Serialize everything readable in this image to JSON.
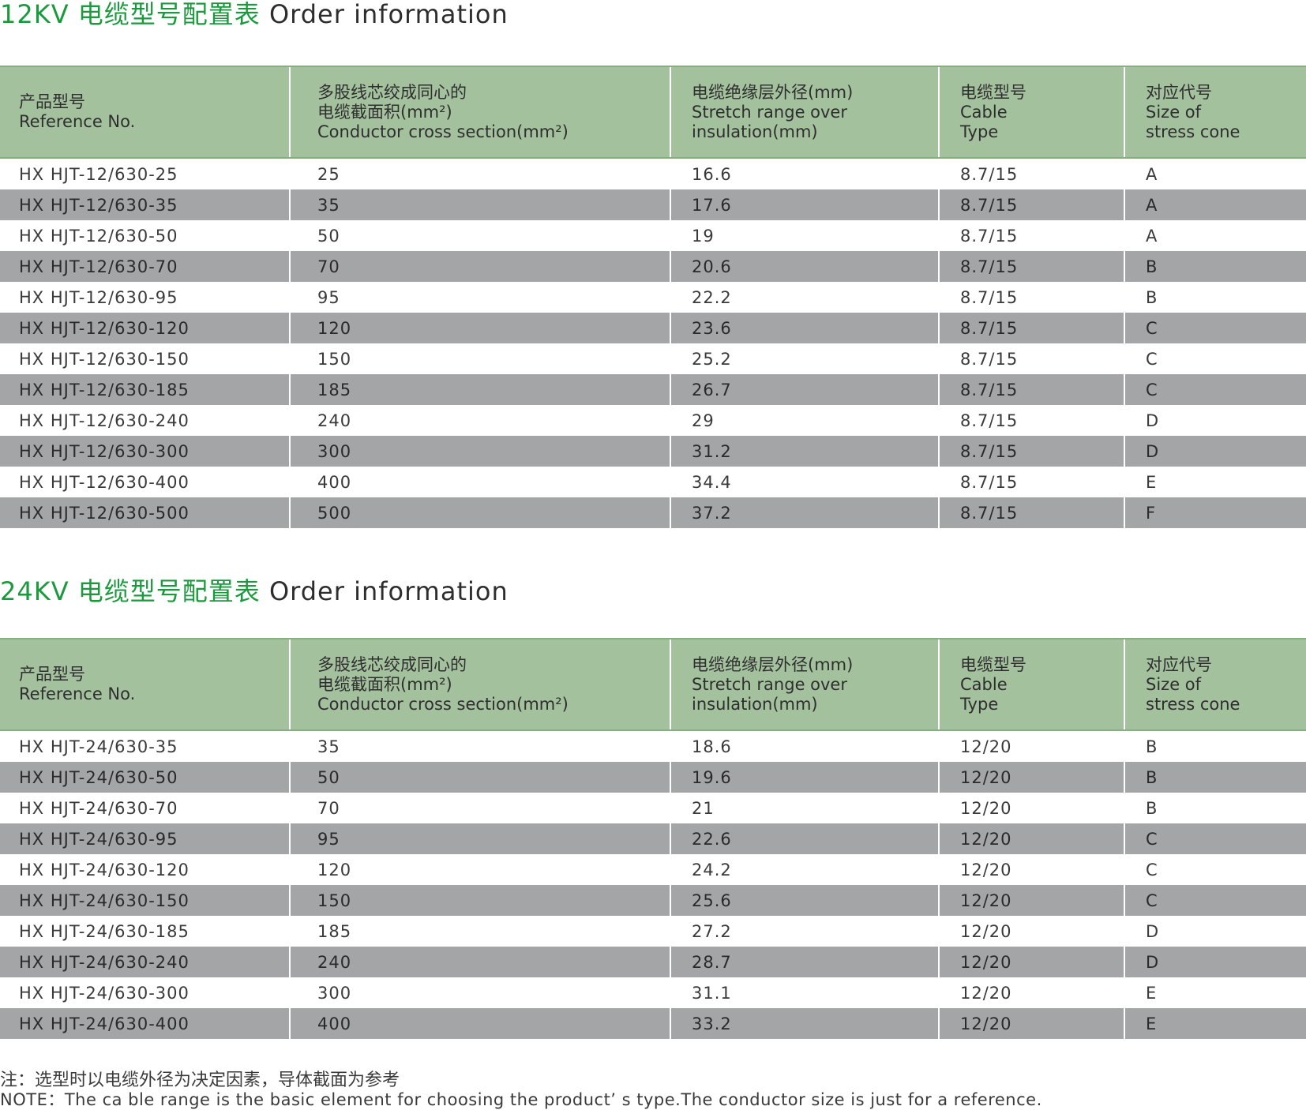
{
  "tables": [
    {
      "title_cn": "12KV 电缆型号配置表",
      "title_en": "Order information",
      "headers": {
        "c1": [
          "产品型号",
          "Reference No."
        ],
        "c2": [
          "多股线芯绞成同心的",
          "电缆截面积(mm²)",
          "Conductor cross section(mm²)"
        ],
        "c3": [
          "电缆绝缘层外径(mm)",
          "Stretch range over",
          "insulation(mm)"
        ],
        "c4": [
          "电缆型号",
          "Cable",
          "Type"
        ],
        "c5": [
          "对应代号",
          "Size of",
          "stress cone"
        ]
      },
      "rows": [
        [
          "HX HJT-12/630-25",
          "25",
          "16.6",
          "8.7/15",
          "A"
        ],
        [
          "HX HJT-12/630-35",
          "35",
          "17.6",
          "8.7/15",
          "A"
        ],
        [
          "HX HJT-12/630-50",
          "50",
          "19",
          "8.7/15",
          "A"
        ],
        [
          "HX HJT-12/630-70",
          "70",
          "20.6",
          "8.7/15",
          "B"
        ],
        [
          "HX HJT-12/630-95",
          "95",
          "22.2",
          "8.7/15",
          "B"
        ],
        [
          "HX HJT-12/630-120",
          "120",
          "23.6",
          "8.7/15",
          "C"
        ],
        [
          "HX HJT-12/630-150",
          "150",
          "25.2",
          "8.7/15",
          "C"
        ],
        [
          "HX HJT-12/630-185",
          "185",
          "26.7",
          "8.7/15",
          "C"
        ],
        [
          "HX HJT-12/630-240",
          "240",
          "29",
          "8.7/15",
          "D"
        ],
        [
          "HX HJT-12/630-300",
          "300",
          "31.2",
          "8.7/15",
          "D"
        ],
        [
          "HX HJT-12/630-400",
          "400",
          "34.4",
          "8.7/15",
          "E"
        ],
        [
          "HX HJT-12/630-500",
          "500",
          "37.2",
          "8.7/15",
          "F"
        ]
      ]
    },
    {
      "title_cn": "24KV 电缆型号配置表",
      "title_en": "Order information",
      "headers": {
        "c1": [
          "产品型号",
          "Reference No."
        ],
        "c2": [
          "多股线芯绞成同心的",
          "电缆截面积(mm²)",
          "Conductor cross section(mm²)"
        ],
        "c3": [
          "电缆绝缘层外径(mm)",
          "Stretch range over",
          "insulation(mm)"
        ],
        "c4": [
          "电缆型号",
          "Cable",
          "Type"
        ],
        "c5": [
          "对应代号",
          "Size of",
          "stress cone"
        ]
      },
      "rows": [
        [
          "HX HJT-24/630-35",
          "35",
          "18.6",
          "12/20",
          "B"
        ],
        [
          "HX HJT-24/630-50",
          "50",
          "19.6",
          "12/20",
          "B"
        ],
        [
          "HX HJT-24/630-70",
          "70",
          "21",
          "12/20",
          "B"
        ],
        [
          "HX HJT-24/630-95",
          "95",
          "22.6",
          "12/20",
          "C"
        ],
        [
          "HX HJT-24/630-120",
          "120",
          "24.2",
          "12/20",
          "C"
        ],
        [
          "HX HJT-24/630-150",
          "150",
          "25.6",
          "12/20",
          "C"
        ],
        [
          "HX HJT-24/630-185",
          "185",
          "27.2",
          "12/20",
          "D"
        ],
        [
          "HX HJT-24/630-240",
          "240",
          "28.7",
          "12/20",
          "D"
        ],
        [
          "HX HJT-24/630-300",
          "300",
          "31.1",
          "12/20",
          "E"
        ],
        [
          "HX HJT-24/630-400",
          "400",
          "33.2",
          "12/20",
          "E"
        ]
      ]
    }
  ],
  "note": {
    "cn": "注：选型时以电缆外径为决定因素，导体截面为参考",
    "en": "NOTE：The ca ble range is the basic element for choosing the product’ s type.The conductor size is just for a reference."
  },
  "colors": {
    "title_accent": "#1a9a3c",
    "header_bg": "#a4c19e",
    "stripe_bg": "#a3a5a7"
  }
}
